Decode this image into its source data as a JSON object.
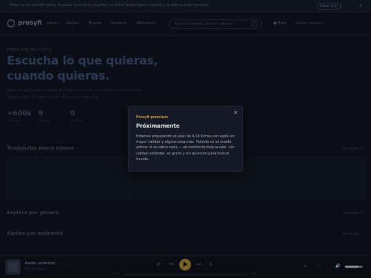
{
  "banner": {
    "text": "Estás en la versión beta. Algunas funciones pueden no estar disponibles todavía y la web puede cambiar.",
    "button": "Saber más",
    "close": "×"
  },
  "nav": {
    "logo": "prosyfi",
    "links": [
      "Inicio",
      "Radios",
      "Buscar",
      "Géneros",
      "Biblioteca"
    ],
    "search_placeholder": "Busca emisoras, países o géneros",
    "search_kbd": "/",
    "premium": "● Beta",
    "lang": "Iniciar sesión ⌄"
  },
  "hero": {
    "eyebrow": "RADIO ONLINE GRATIS",
    "title_line1": "Escucha lo que quieras,",
    "title_line2": "cuando quieras.",
    "subtitle": "Miles de emisoras de radio de todo el mundo, sin registro, sin anuncios. Elige tu país, tu género o tu idioma y pulsa play."
  },
  "stats": [
    {
      "value": "+600k",
      "label": "emisoras"
    },
    {
      "value": "9",
      "label": "géneros"
    },
    {
      "value": "0",
      "label": "anuncios"
    }
  ],
  "sections": {
    "trending_title": "Tendencias ahora mismo",
    "trending_more": "Ver todas →",
    "genres_title": "Explora por género",
    "genres_more": "Ver todos →",
    "mood_title": "Radios por ambiente",
    "mood_more": "Ver todas →"
  },
  "player": {
    "title": "Radio anterior",
    "artist": "Sin reproducir",
    "fav": "♡",
    "shuffle": "⇄",
    "prev": "⏮",
    "next": "⏭",
    "repeat": "↻",
    "time_start": "0:00",
    "time_end": "0:00",
    "icons": [
      "≡",
      "▭",
      "🔊"
    ],
    "volume": 0.75
  },
  "modal": {
    "eyebrow": "Prosyfi premium",
    "title": "Próximamente",
    "body": "Estamos preparando un plan de 4,99 €/mes con audio en mayor calidad y alguna cosa más. Todavía no se puede activar ni se cobra nada — de momento toda la web, con calidad estándar, es gratis y sin anuncios para todo el mundo.",
    "close": "×"
  }
}
